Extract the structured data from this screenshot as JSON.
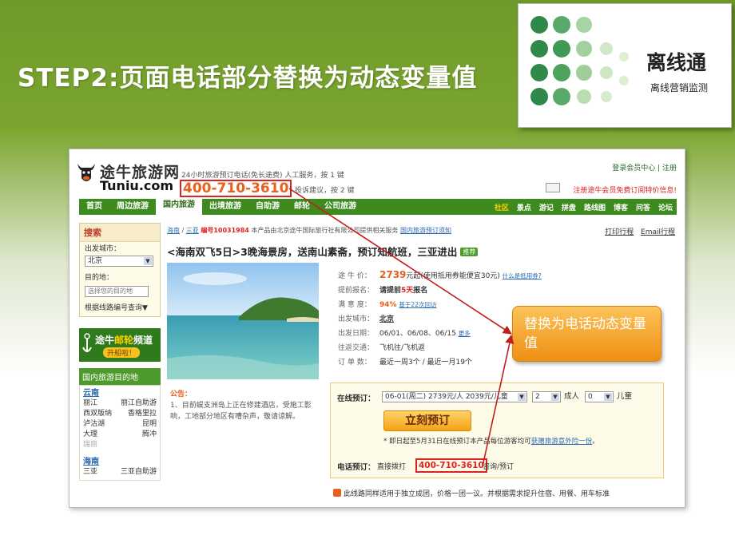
{
  "slide": {
    "title": "STEP2:页面电话部分替换为动态变量值",
    "brand_name": "离线通",
    "brand_subtitle": "离线营销监测",
    "callout_text": "替换为电话动态变量值"
  },
  "site": {
    "logo_cn": "途牛旅游网",
    "logo_en": "Tuniu.com",
    "hotline_line1": "24小时旅游预订电话(免长途费) 人工服务，按 1 键",
    "phone": "400-710-3610",
    "hotline_line2": "投诉建议，按 2 键",
    "top_links": "登录会员中心 | 注册",
    "promo_link": "注册途牛会员免费订阅特价信息!",
    "nav": {
      "items": [
        "首页",
        "周边旅游",
        "国内旅游",
        "出境旅游",
        "自助游",
        "邮轮",
        "公司旅游"
      ],
      "right": [
        "社区",
        "景点",
        "游记",
        "拼盘",
        "路线图",
        "博客",
        "问答",
        "论坛"
      ]
    },
    "sidebar": {
      "search_title": "搜索",
      "depart_label": "出发城市：",
      "depart_value": "北京",
      "dest_label": "目的地：",
      "dest_placeholder": "选择您的目的地",
      "id_query": "根据线路编号查询▼",
      "cruise_title_a": "途牛",
      "cruise_title_b": "邮轮",
      "cruise_title_c": "频道",
      "cruise_badge": "开船啦！",
      "dest_header": "国内旅游目的地",
      "province1": "云南",
      "province1_rows": [
        [
          "丽江",
          "丽江自助游"
        ],
        [
          "西双版纳",
          "香格里拉"
        ],
        [
          "泸沽湖",
          "昆明"
        ],
        [
          "大理",
          "腾冲"
        ]
      ],
      "province1_more": "瑞丽",
      "province2": "海南",
      "province2_rows": [
        [
          "三亚",
          "三亚自助游"
        ]
      ]
    },
    "breadcrumb": {
      "home": "海南",
      "city": "三亚",
      "id_text": "编号10031984",
      "desc": "本产品由北京途牛国际旅行社有限公司提供相关服务",
      "notice_link": "国内旅游预订须知",
      "print": "打印行程",
      "email": "Email行程"
    },
    "product": {
      "title": "<海南双飞5日>3晚海景房，送南山素斋，预订知航班，三亚进出",
      "tag": "推荐",
      "price_label": "途 牛 价：",
      "price": "2739",
      "price_note": "元起(使用抵用券能便宜30元)",
      "price_link": "什么是抵用券?",
      "advance_label": "提前报名：",
      "advance_value_a": "请提前",
      "advance_value_b": "5天",
      "advance_value_c": "报名",
      "satisfaction_label": "满 意 度：",
      "satisfaction_value": "94%",
      "satisfaction_link": "基于22次回访",
      "depart_label": "出发城市：",
      "depart_value": "北京",
      "dates_label": "出发日期：",
      "dates_value": "06/01、06/08、06/15",
      "dates_more": "更多",
      "transport_label": "往返交通：",
      "transport_value": "飞机往/飞机返",
      "orders_label": "订 单 数：",
      "orders_value": "最近一周3个 / 最近一月19个"
    },
    "notice": {
      "title": "公告：",
      "body": "1、目前蜈支洲岛上正在修建酒店，受施工影响，工地部分地区有嘈杂声，敬请谅解。"
    },
    "booking": {
      "online_label": "在线预订：",
      "date_option": "06-01(周二) 2739元/人 2039元/儿童",
      "adults": "2",
      "adults_label": "成人",
      "children": "0",
      "children_label": "儿童",
      "button": "立刻预订",
      "note_a": "* 即日起至5月31日在线预订本产品每位游客均可",
      "note_link": "获赠旅游意外险一份",
      "note_b": "。",
      "phone_label": "电话预订：",
      "phone_pre": "直接拨打",
      "phone": "400-710-3610",
      "phone_post": "咨询/预订"
    },
    "bottom_text": "此线路同样适用于独立成团，价格一团一议。并根据需求提升住宿、用餐、用车标准"
  },
  "colors": {
    "slide_green": "#7ba52f",
    "site_green": "#3d8a1e",
    "highlight_red": "#d22222",
    "callout_orange": "#f29a18"
  }
}
